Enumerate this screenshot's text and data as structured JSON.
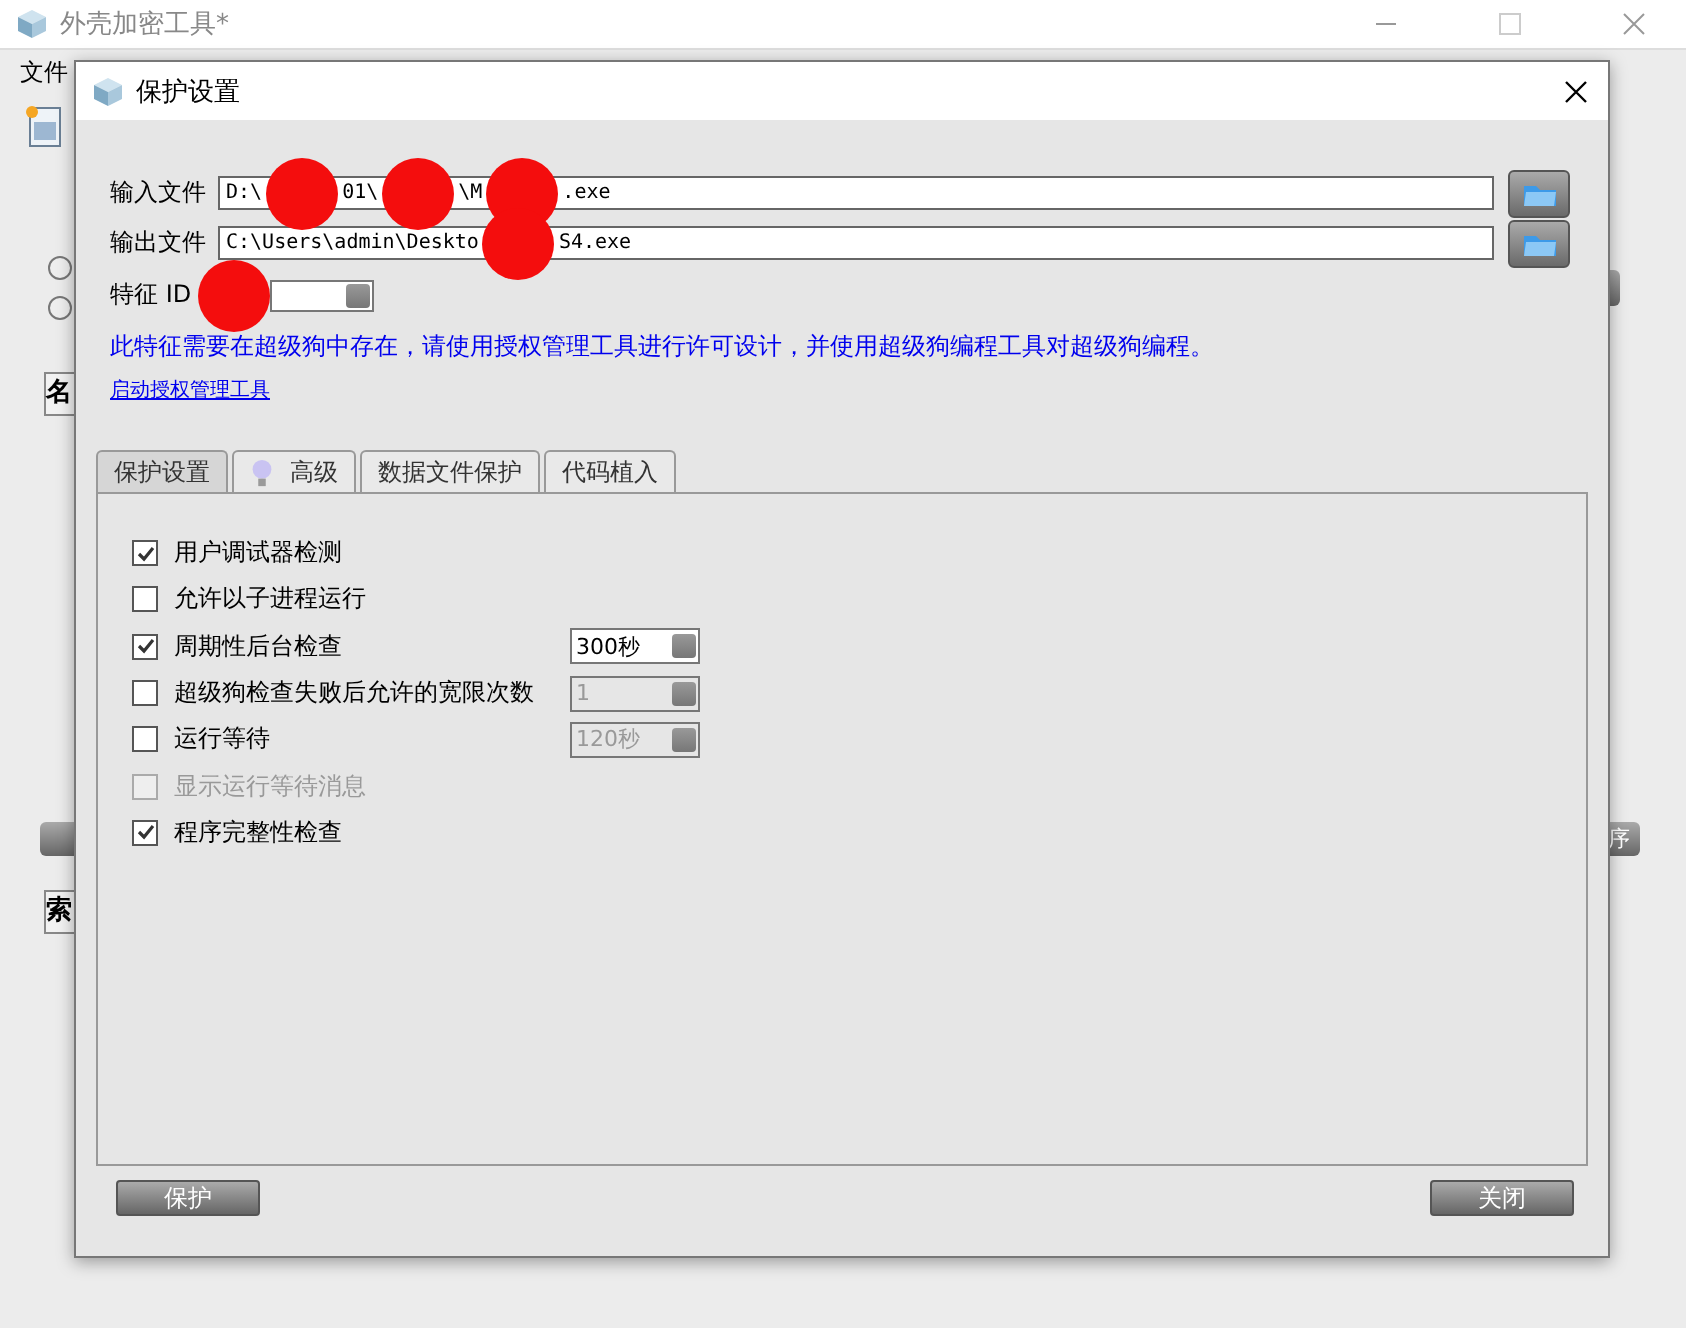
{
  "main_window": {
    "title": "外壳加密工具*",
    "menu": [
      "文件"
    ],
    "radios": [
      {
        "selected": false
      },
      {
        "selected": false
      }
    ],
    "table_headers": [
      "名",
      "索"
    ],
    "side_button": "序"
  },
  "dialog": {
    "title": "保护设置",
    "fields": [
      {
        "label": "输入文件",
        "value_parts": [
          "D:\\",
          "01\\",
          "\\M",
          ".exe"
        ]
      },
      {
        "label": "输出文件",
        "value_parts": [
          "C:\\Users\\admin\\Deskto",
          "S4.exe"
        ]
      }
    ],
    "feature_id": {
      "label": "特征 ID"
    },
    "info": "此特征需要在超级狗中存在，请使用授权管理工具进行许可设计，并使用超级狗编程工具对超级狗编程。",
    "link": "启动授权管理工具",
    "tabs": [
      {
        "label": "保护设置",
        "selected": true,
        "icon": false
      },
      {
        "label": "高级",
        "selected": false,
        "icon": true
      },
      {
        "label": "数据文件保护",
        "selected": false,
        "icon": false
      },
      {
        "label": "代码植入",
        "selected": false,
        "icon": false
      }
    ],
    "options": [
      {
        "label": "用户调试器检测",
        "checked": true,
        "disabled": false
      },
      {
        "label": "允许以子进程运行",
        "checked": false,
        "disabled": false
      },
      {
        "label": "周期性后台检查",
        "checked": true,
        "disabled": false,
        "spin": {
          "value": "300秒",
          "disabled": false
        }
      },
      {
        "label": "超级狗检查失败后允许的宽限次数",
        "checked": false,
        "disabled": false,
        "spin": {
          "value": "1",
          "disabled": true
        }
      },
      {
        "label": "运行等待",
        "checked": false,
        "disabled": false,
        "spin": {
          "value": "120秒",
          "disabled": true
        }
      },
      {
        "label": "显示运行等待消息",
        "checked": false,
        "disabled": true
      },
      {
        "label": "程序完整性检查",
        "checked": true,
        "disabled": false
      }
    ],
    "buttons": [
      "保护",
      "关闭"
    ]
  }
}
